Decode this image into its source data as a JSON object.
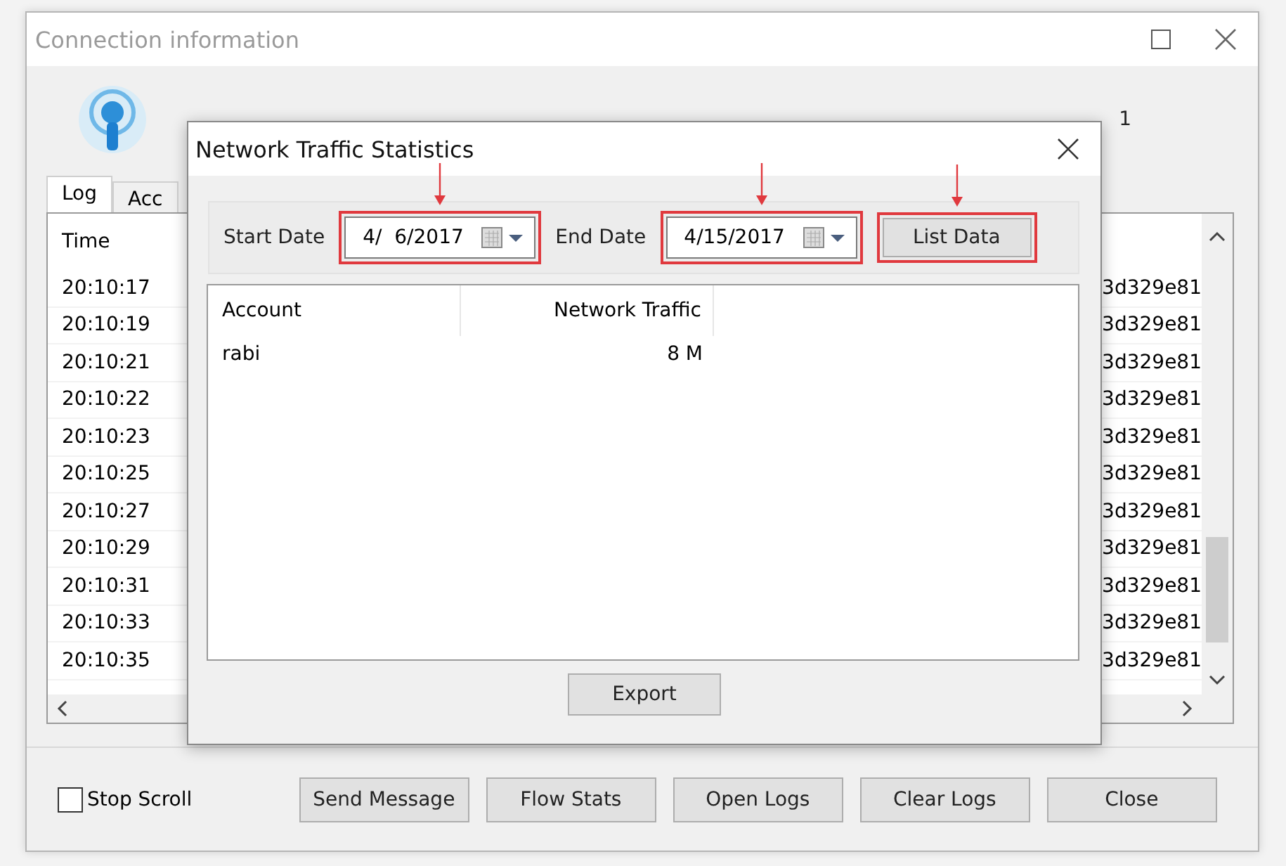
{
  "window": {
    "title": "Connection information"
  },
  "header": {
    "users": "1"
  },
  "tabs": [
    {
      "label": "Log",
      "selected": true
    },
    {
      "label": "Acc",
      "selected": false
    }
  ],
  "log": {
    "columns": [
      "Time"
    ],
    "rows": [
      {
        "time": "20:10:17",
        "column_2": "3d329e81"
      },
      {
        "time": "20:10:19",
        "column_2": "3d329e81"
      },
      {
        "time": "20:10:21",
        "column_2": "3d329e81"
      },
      {
        "time": "20:10:22",
        "column_2": "3d329e81"
      },
      {
        "time": "20:10:23",
        "column_2": "3d329e81"
      },
      {
        "time": "20:10:25",
        "column_2": "3d329e81"
      },
      {
        "time": "20:10:27",
        "column_2": "3d329e81"
      },
      {
        "time": "20:10:29",
        "column_2": "3d329e81"
      },
      {
        "time": "20:10:31",
        "column_2": "3d329e81"
      },
      {
        "time": "20:10:33",
        "column_2": "3d329e81"
      },
      {
        "time": "20:10:35",
        "column_2": "3d329e81"
      }
    ]
  },
  "stop_scroll": {
    "label": "Stop Scroll",
    "checked": false
  },
  "buttons": [
    "Send Message",
    "Flow Stats",
    "Open Logs",
    "Clear Logs",
    "Close"
  ],
  "dialog": {
    "title": "Network Traffic Statistics",
    "start": {
      "label": "Start Date",
      "value": "4/  6/2017",
      "highlighted": true
    },
    "end": {
      "label": "End Date",
      "value": "4/15/2017",
      "highlighted": true
    },
    "list_button": {
      "label": "List Data",
      "highlighted": true
    },
    "columns": [
      "Account",
      "Network Traffic"
    ],
    "rows": [
      [
        "rabi",
        "8 M"
      ]
    ],
    "export": "Export"
  }
}
